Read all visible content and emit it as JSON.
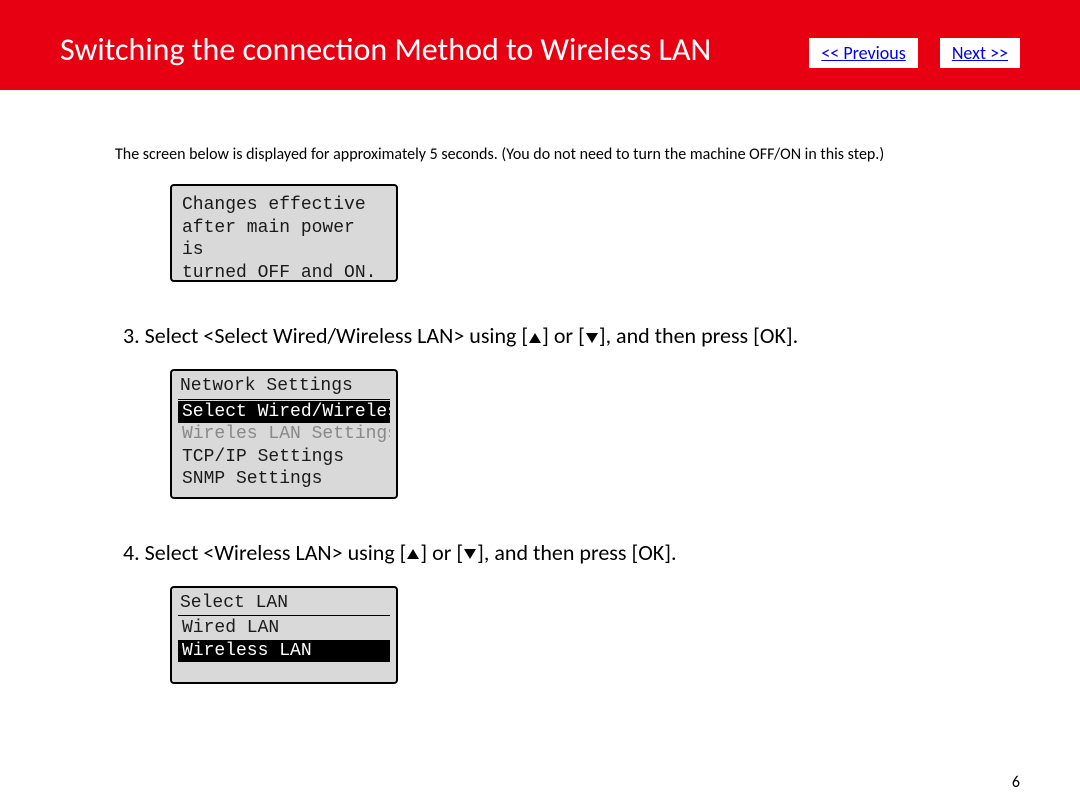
{
  "header": {
    "title": "Switching the connection Method to Wireless LAN",
    "prev_label": "<< Previous",
    "next_label": "Next >>"
  },
  "intro": "The screen below is displayed for approximately 5 seconds. (You do not need to turn the machine OFF/ON in this step.)",
  "screen1": {
    "line1": "Changes effective",
    "line2": "after main power is",
    "line3": "turned OFF and ON."
  },
  "step3": {
    "prefix": "3. Select <Select Wired/Wireless LAN> using [",
    "mid": "] or [",
    "suffix": "], and then press [OK]."
  },
  "screen2": {
    "title": "Network Settings",
    "item1": "Select Wired/Wireles",
    "item2": "Wireles LAN Settings",
    "item3": "TCP/IP Settings",
    "item4": "SNMP Settings"
  },
  "step4": {
    "prefix": "4. Select <Wireless LAN> using [",
    "mid": "] or [",
    "suffix": "], and then press [OK]."
  },
  "screen3": {
    "title": "Select LAN",
    "item1": "Wired LAN",
    "item2": "Wireless LAN"
  },
  "page_number": "6"
}
